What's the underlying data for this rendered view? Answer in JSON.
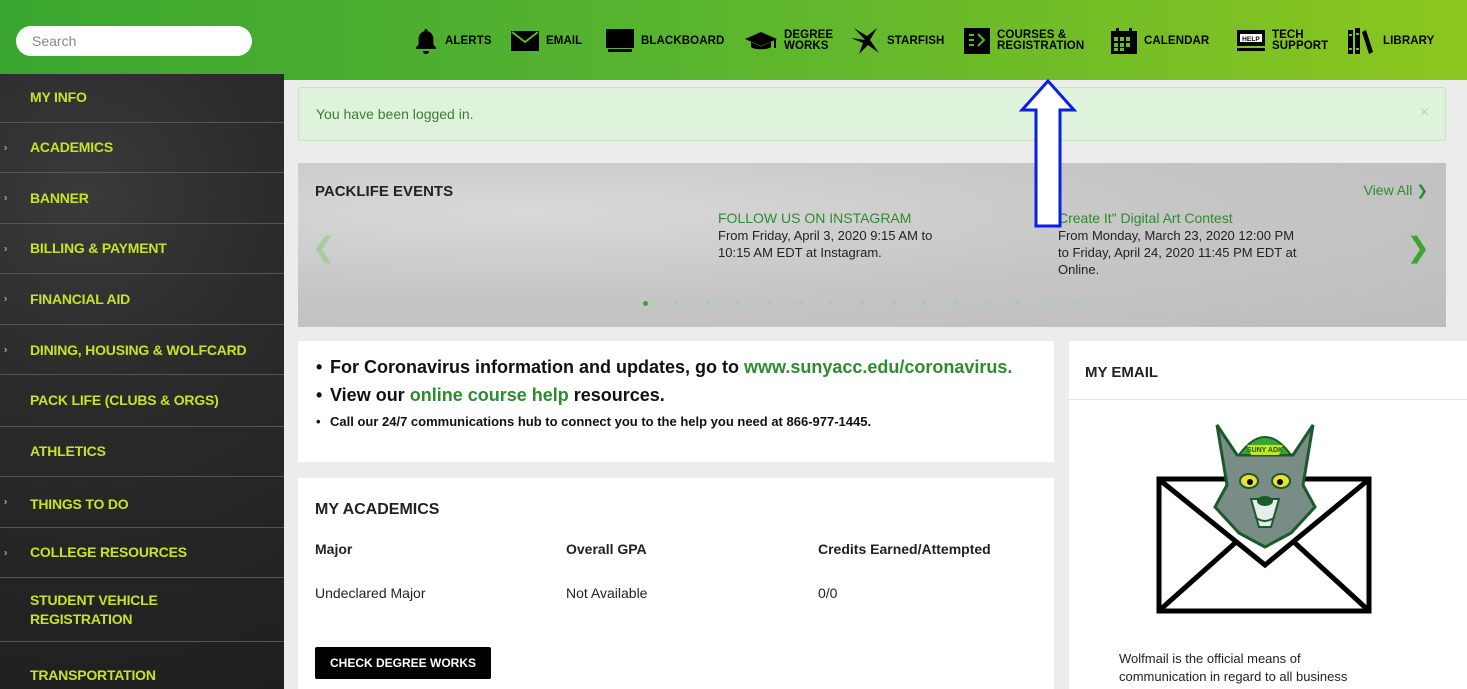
{
  "search": {
    "placeholder": "Search"
  },
  "topnav": {
    "alerts": "ALERTS",
    "email": "EMAIL",
    "blackboard": "BLACKBOARD",
    "degree_works_1": "DEGREE",
    "degree_works_2": "WORKS",
    "starfish": "STARFISH",
    "courses_1": "COURSES &",
    "courses_2": "REGISTRATION",
    "calendar": "CALENDAR",
    "tech_1": "TECH",
    "tech_2": "SUPPORT",
    "library": "LIBRARY",
    "help_badge": "HELP"
  },
  "sidebar": {
    "items": [
      {
        "label": "MY INFO"
      },
      {
        "label": "ACADEMICS"
      },
      {
        "label": "BANNER"
      },
      {
        "label": "BILLING & PAYMENT"
      },
      {
        "label": "FINANCIAL AID"
      },
      {
        "label": "DINING, HOUSING & WOLFCARD"
      },
      {
        "label": "PACK LIFE (CLUBS & ORGS)"
      },
      {
        "label": "ATHLETICS"
      },
      {
        "label": "THINGS TO DO"
      },
      {
        "label": "COLLEGE RESOURCES"
      },
      {
        "label_1": "STUDENT VEHICLE",
        "label_2": "REGISTRATION"
      },
      {
        "label": "TRANSPORTATION"
      }
    ]
  },
  "alert": {
    "message": "You have been logged in.",
    "close": "×"
  },
  "events": {
    "title": "PACKLIFE EVENTS",
    "view_all": "View All",
    "items": [
      {
        "title": "FOLLOW US ON INSTAGRAM",
        "line1": "From Friday, April 3, 2020 9:15 AM to",
        "line2": "10:15 AM EDT at Instagram."
      },
      {
        "title": "Create It\" Digital Art Contest",
        "line1": "From Monday, March 23, 2020 12:00 PM",
        "line2": "to Friday, April 24, 2020 11:45 PM EDT at",
        "line3": "Online."
      }
    ],
    "dot_count": 15,
    "active_dot": 0
  },
  "covid": {
    "line1_pre": "For Coronavirus information and updates, go to ",
    "line1_link": "www.sunyacc.edu/coronavirus.",
    "line2_pre": "View our ",
    "line2_link": "online course help",
    "line2_post": " resources.",
    "line3": "Call our 24/7 communications hub to connect you to the help you need at 866-977-1445."
  },
  "academics": {
    "title": "MY ACADEMICS",
    "headers": [
      "Major",
      "Overall GPA",
      "Credits Earned/Attempted"
    ],
    "values": [
      "Undeclared Major",
      "Not Available",
      "0/0"
    ],
    "button": "CHECK DEGREE WORKS"
  },
  "email": {
    "title": "MY EMAIL",
    "hat_text": "SUNY ADK",
    "text_line1": "Wolfmail is the official means of",
    "text_line2": "communication in regard to all business"
  },
  "colors": {
    "brand_green": "#3aa62f",
    "lime": "#c5e327",
    "link_green": "#2e8b2e",
    "annotation_blue": "#0a1ee6"
  }
}
